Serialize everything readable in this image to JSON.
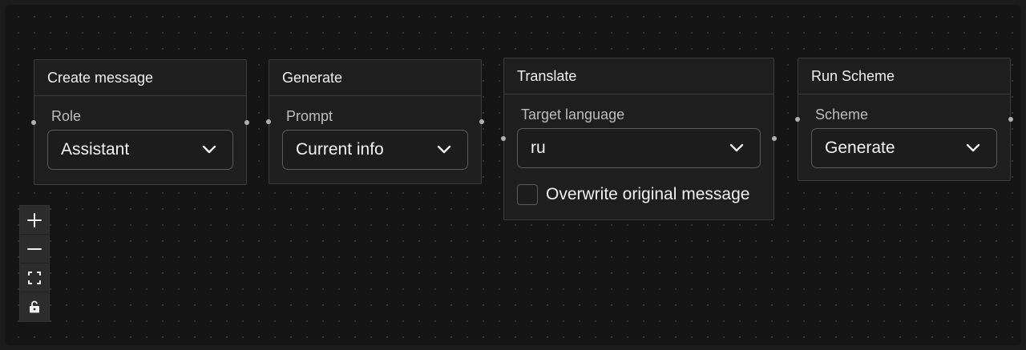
{
  "nodes": [
    {
      "title": "Create message",
      "field_label": "Role",
      "value": "Assistant"
    },
    {
      "title": "Generate",
      "field_label": "Prompt",
      "value": "Current info"
    },
    {
      "title": "Translate",
      "field_label": "Target language",
      "value": "ru",
      "checkbox_label": "Overwrite original message",
      "checkbox_checked": false
    },
    {
      "title": "Run Scheme",
      "field_label": "Scheme",
      "value": "Generate"
    }
  ],
  "controls": {
    "icons": [
      "plus-icon",
      "minus-icon",
      "fit-view-icon",
      "lock-icon"
    ]
  }
}
